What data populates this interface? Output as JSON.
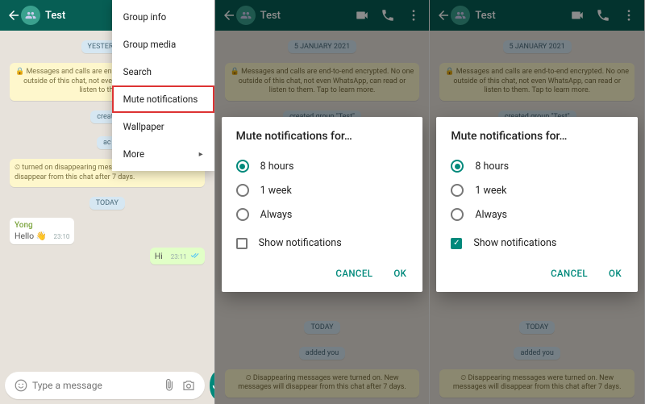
{
  "topbar": {
    "title": "Test"
  },
  "input": {
    "placeholder": "Type a message"
  },
  "menu": {
    "items": [
      "Group info",
      "Group media",
      "Search",
      "Mute notifications",
      "Wallpaper",
      "More"
    ],
    "highlight_index": 3
  },
  "dialog": {
    "title": "Mute notifications for…",
    "options": [
      "8 hours",
      "1 week",
      "Always"
    ],
    "selected": 0,
    "show_notifications_label": "Show notifications",
    "cancel": "CANCEL",
    "ok": "OK"
  },
  "chat": {
    "date_top": "5 JANUARY 2021",
    "p1_date_top": "YESTERDAY",
    "encryption_full": "🔒 Messages and calls are end-to-end encrypted. No one outside of this chat, not even WhatsApp, can read or listen to them. Tap to learn more.",
    "encryption_trunc": "🔒 Messages and calls are end-to-end encrypted. No one outside of this chat, not even WhatsApp, can read or listen to them. Ta",
    "created_group": "created group \"Test\"",
    "created_trunc": "create",
    "added_short": "ac",
    "disappearing_on": "turned on disappearing messages. New messages will disappear from this chat after 7 days.",
    "disappearing_full": "⏲ Disappearing messages were turned on. New messages will disappear from this chat after 7 days.",
    "date_today": "TODAY",
    "added_you": "added you",
    "sender": "Yong",
    "msg_in": "Hello 👋",
    "msg_in_time": "23:10",
    "msg_out": "Hi",
    "msg_out_time": "23:11"
  },
  "panel3_show_checked": true,
  "panel2_show_checked": false
}
